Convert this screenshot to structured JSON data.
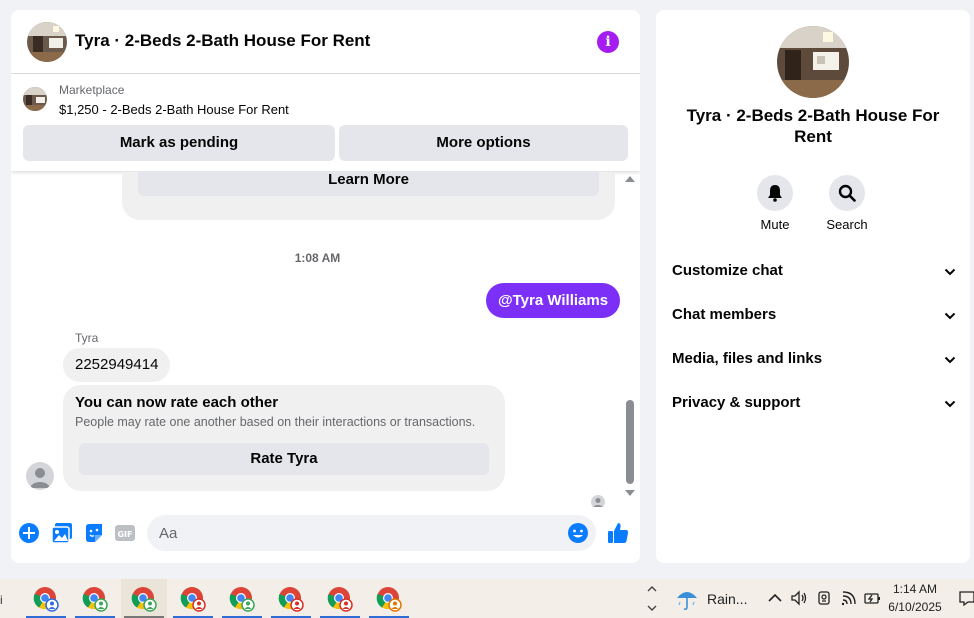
{
  "chat": {
    "title": "Tyra · 2-Beds 2-Bath House For Rent",
    "marketplace": {
      "label": "Marketplace",
      "listing": "$1,250 - 2-Beds 2-Bath House For Rent",
      "mark_pending": "Mark as pending",
      "more_options": "More options"
    },
    "messages": {
      "learn_more": "Learn More",
      "timestamp": "1:08 AM",
      "mention": "@Tyra Williams",
      "sender": "Tyra",
      "phone_message": "2252949414",
      "rating_title": "You can now rate each other",
      "rating_subtitle": "People may rate one another based on their interactions or transactions.",
      "rate_button": "Rate Tyra"
    },
    "composer": {
      "placeholder": "Aa"
    }
  },
  "details": {
    "title": "Tyra · 2-Beds 2-Bath House For Rent",
    "mute": "Mute",
    "search": "Search",
    "sections": [
      "Customize chat",
      "Chat members",
      "Media, files and links",
      "Privacy & support"
    ]
  },
  "taskbar": {
    "edge_glyph": "i",
    "weather": "Rain...",
    "time": "1:14 AM",
    "date": "6/10/2025",
    "apps": [
      "chrome-profile-blue",
      "chrome-profile-green",
      "chrome-profile-green",
      "chrome-profile-red",
      "chrome-profile-green",
      "chrome-profile-red",
      "chrome-profile-red",
      "chrome-profile-orange"
    ]
  },
  "colors": {
    "accent_blue": "#0a7cff",
    "info_purple": "#a51cf0",
    "mention_purple": "#7b2ff7"
  }
}
